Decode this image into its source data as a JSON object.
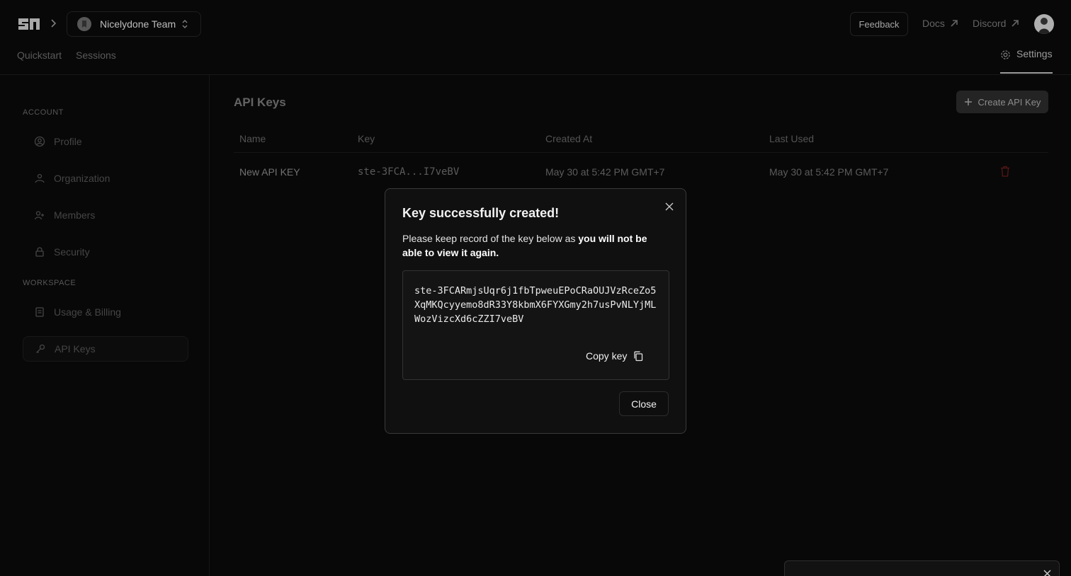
{
  "header": {
    "team_name": "Nicelydone Team",
    "feedback_label": "Feedback",
    "docs_label": "Docs",
    "discord_label": "Discord"
  },
  "nav": {
    "tabs": [
      {
        "label": "Quickstart"
      },
      {
        "label": "Sessions"
      }
    ],
    "settings_label": "Settings"
  },
  "sidebar": {
    "account_label": "ACCOUNT",
    "workspace_label": "WORKSPACE",
    "items": [
      {
        "label": "Profile",
        "icon": "user-circle-icon"
      },
      {
        "label": "Organization",
        "icon": "organization-icon"
      },
      {
        "label": "Members",
        "icon": "members-icon"
      },
      {
        "label": "Security",
        "icon": "lock-icon"
      },
      {
        "label": "Usage & Billing",
        "icon": "receipt-icon"
      },
      {
        "label": "API Keys",
        "icon": "key-icon"
      }
    ]
  },
  "main": {
    "title": "API Keys",
    "create_label": "Create API Key",
    "columns": [
      "Name",
      "Key",
      "Created At",
      "Last Used"
    ],
    "rows": [
      {
        "name": "New API KEY",
        "key": "ste-3FCA...I7veBV",
        "created_at": "May 30 at 5:42 PM GMT+7",
        "last_used": "May 30 at 5:42 PM GMT+7"
      }
    ]
  },
  "modal": {
    "title": "Key successfully created!",
    "desc_plain": "Please keep record of the key below as ",
    "desc_bold": "you will not be able to view it again.",
    "key": "ste-3FCARmjsUqr6j1fbTpweuEPoCRaOUJVzRceZo5XqMKQcyyemo8dR33Y8kbmX6FYXGmy2h7usPvNLYjMLWozVizcXd6cZZI7veBV",
    "copy_label": "Copy key",
    "close_label": "Close"
  },
  "colors": {
    "background": "#0a0a0a",
    "danger": "#7a1f1f"
  }
}
